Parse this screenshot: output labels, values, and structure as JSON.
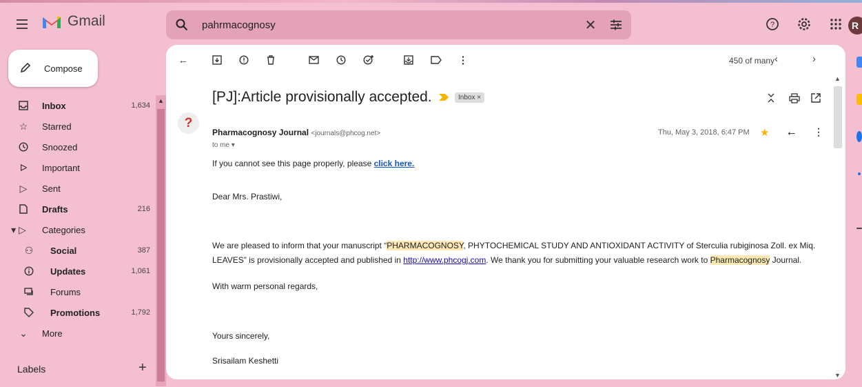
{
  "app": {
    "name": "Gmail",
    "avatar_letter": "R"
  },
  "search": {
    "value": "pahrmacognosy"
  },
  "compose": {
    "label": "Compose"
  },
  "sidebar": {
    "items": [
      {
        "label": "Inbox",
        "count": "1,634",
        "icon": "inbox-icon",
        "bold": true
      },
      {
        "label": "Starred",
        "count": "",
        "icon": "star-icon",
        "bold": false
      },
      {
        "label": "Snoozed",
        "count": "",
        "icon": "clock-icon",
        "bold": false
      },
      {
        "label": "Important",
        "count": "",
        "icon": "important-icon",
        "bold": false
      },
      {
        "label": "Sent",
        "count": "",
        "icon": "send-icon",
        "bold": false
      },
      {
        "label": "Drafts",
        "count": "216",
        "icon": "draft-icon",
        "bold": true
      },
      {
        "label": "Categories",
        "count": "",
        "icon": "label-icon",
        "bold": false
      }
    ],
    "categories": [
      {
        "label": "Social",
        "count": "387",
        "icon": "people-icon",
        "bold": true
      },
      {
        "label": "Updates",
        "count": "1,061",
        "icon": "info-icon",
        "bold": true
      },
      {
        "label": "Forums",
        "count": "",
        "icon": "forum-icon",
        "bold": false
      },
      {
        "label": "Promotions",
        "count": "1,792",
        "icon": "tag-icon",
        "bold": true
      }
    ],
    "more_label": "More",
    "labels_heading": "Labels"
  },
  "toolbar": {
    "pager": "450 of many"
  },
  "email": {
    "subject": "[PJ]:Article provisionally accepted.",
    "chip": "Inbox ×",
    "sender_name": "Pharmacognosy Journal",
    "sender_email": "<journals@phcog.net>",
    "to": "to me ▾",
    "date": "Thu, May 3, 2018, 6:47 PM",
    "line1_pre": "If you cannot see this page properly, please ",
    "line1_link": "click here.",
    "greeting": "Dear Mrs. Prastiwi,",
    "p1_a": "We are pleased to inform that your manuscript “",
    "p1_hl1": "PHARMACOGNOSY",
    "p1_b": ", PHYTOCHEMICAL STUDY AND ANTIOXIDANT ACTIVITY of Sterculia rubiginosa Zoll. ex Miq.",
    "p2_a": "LEAVES” is provisionally accepted and published in ",
    "p2_link": "http://www.phcogj.com",
    "p2_b": ". We thank you for submitting your valuable research work to ",
    "p2_hl2": "Pharmacognosy",
    "p2_c": " Journal.",
    "regards": "With warm personal regards,",
    "closing": "Yours sincerely,",
    "signature": "Srisailam Keshetti"
  },
  "colors": {
    "background": "#f4bfd0",
    "search_bg": "#e3a2b7",
    "highlight": "#fce8b2",
    "star": "#f4b400"
  }
}
